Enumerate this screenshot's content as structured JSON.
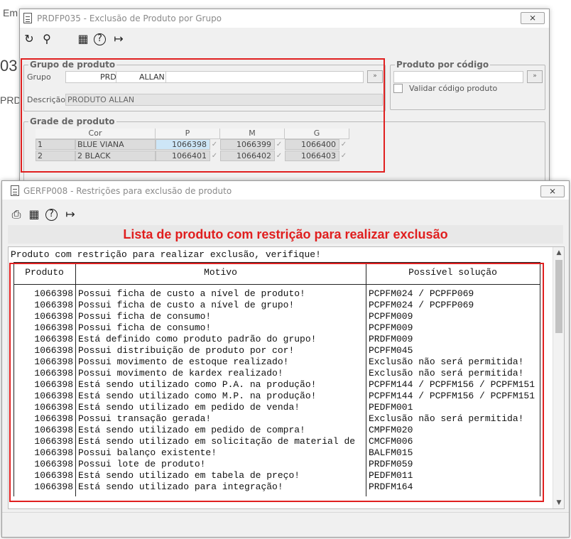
{
  "background": {
    "top_left_text": "Em",
    "side_text_1": "03",
    "side_text_2": "PRD"
  },
  "window1": {
    "title": "PRDFP035 - Exclusão de Produto por Grupo",
    "close_label": "⨯",
    "toolbar": {
      "refresh_icon": "↻",
      "search_icon": "⚲",
      "calendar_icon": "▦",
      "help_icon": "?",
      "exit_icon": "↦"
    },
    "grupo_produto": {
      "legend": "Grupo de produto",
      "grupo_label": "Grupo",
      "grupo_code": "PRD",
      "grupo_name": "ALLAN",
      "lookup_label": "»",
      "descricao_label": "Descrição",
      "descricao_value": "PRODUTO ALLAN"
    },
    "produto_codigo": {
      "legend": "Produto por código",
      "value": "",
      "lookup_label": "»",
      "validar_label": "Validar código produto"
    },
    "grade": {
      "legend": "Grade de produto",
      "headers": [
        "Cor",
        "P",
        "M",
        "G"
      ],
      "rows": [
        {
          "num": "1",
          "cor": "BLUE VIANA",
          "p": "1066398",
          "m": "1066399",
          "g": "1066400"
        },
        {
          "num": "2",
          "cor": "2 BLACK",
          "p": "1066401",
          "m": "1066402",
          "g": "1066403"
        }
      ],
      "tick": "✓"
    }
  },
  "window2": {
    "title": "GERFP008 - Restrições para exclusão de produto",
    "close_label": "⨯",
    "toolbar": {
      "print_icon": "⎙",
      "calendar_icon": "▦",
      "help_icon": "?",
      "exit_icon": "↦"
    },
    "banner": "Lista de produto com restrição para realizar exclusão",
    "intro": "Produto com restrição para realizar exclusão, verifique!",
    "table": {
      "headers": [
        "Produto",
        "Motivo",
        "Possível solução"
      ],
      "rows": [
        {
          "produto": "1066398",
          "motivo": "Possui ficha de custo a nível de produto!",
          "solucao": "PCPFM024 / PCPFP069"
        },
        {
          "produto": "1066398",
          "motivo": "Possui ficha de custo a nível de grupo!",
          "solucao": "PCPFM024 / PCPFP069"
        },
        {
          "produto": "1066398",
          "motivo": "Possui ficha de consumo!",
          "solucao": "PCPFM009"
        },
        {
          "produto": "1066398",
          "motivo": "Possui ficha de consumo!",
          "solucao": "PCPFM009"
        },
        {
          "produto": "1066398",
          "motivo": "Está definido como produto padrão do grupo!",
          "solucao": "PRDFM009"
        },
        {
          "produto": "1066398",
          "motivo": "Possui distribuição de produto por cor!",
          "solucao": "PCPFM045"
        },
        {
          "produto": "1066398",
          "motivo": "Possui movimento de estoque realizado!",
          "solucao": "Exclusão não será permitida!"
        },
        {
          "produto": "1066398",
          "motivo": "Possui movimento de kardex realizado!",
          "solucao": "Exclusão não será permitida!"
        },
        {
          "produto": "1066398",
          "motivo": "Está sendo utilizado como P.A. na produção!",
          "solucao": "PCPFM144 / PCPFM156 / PCPFM151"
        },
        {
          "produto": "1066398",
          "motivo": "Está sendo utilizado como M.P. na produção!",
          "solucao": "PCPFM144 / PCPFM156 / PCPFM151"
        },
        {
          "produto": "1066398",
          "motivo": "Está sendo utilizado em pedido de venda!",
          "solucao": "PEDFM001"
        },
        {
          "produto": "1066398",
          "motivo": "Possui transação gerada!",
          "solucao": "Exclusão não será permitida!"
        },
        {
          "produto": "1066398",
          "motivo": "Está sendo utilizado em pedido de compra!",
          "solucao": "CMPFM020"
        },
        {
          "produto": "1066398",
          "motivo": "Está sendo utilizado em solicitação de material de",
          "solucao": "CMCFM006"
        },
        {
          "produto": "1066398",
          "motivo": "Possui balanço existente!",
          "solucao": "BALFM015"
        },
        {
          "produto": "1066398",
          "motivo": "Possui lote de produto!",
          "solucao": "PRDFM059"
        },
        {
          "produto": "1066398",
          "motivo": "Está sendo utilizado em tabela de preço!",
          "solucao": "PEDFM011"
        },
        {
          "produto": "1066398",
          "motivo": "Está sendo utilizado para integração!",
          "solucao": "PRDFM164"
        }
      ]
    },
    "scroll": {
      "up": "▲",
      "down": "▼"
    }
  },
  "colors": {
    "highlight_red": "#e02020",
    "banner_red": "#e01e1e",
    "selected_cell": "#cde6f7"
  }
}
